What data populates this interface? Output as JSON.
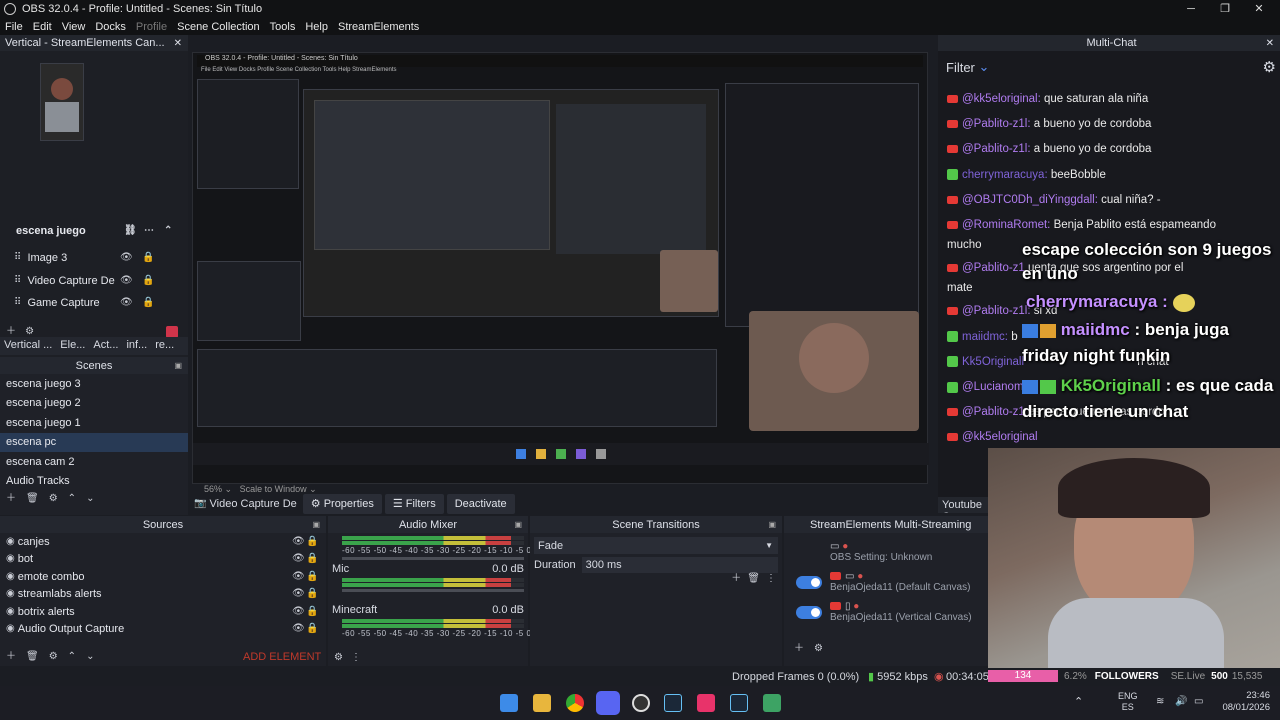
{
  "window": {
    "title": "OBS 32.0.4 - Profile: Untitled - Scenes: Sin Título"
  },
  "menu": [
    "File",
    "Edit",
    "View",
    "Docks",
    "Profile",
    "Scene Collection",
    "Tools",
    "Help",
    "StreamElements"
  ],
  "vertical_dock": {
    "title": "Vertical - StreamElements Can...",
    "scene_name": "escena juego",
    "sources": [
      "Image 3",
      "Video Capture De",
      "Game Capture"
    ],
    "tabs": [
      "Vertical ...",
      "Ele...",
      "Act...",
      "inf...",
      "re..."
    ]
  },
  "scenes": {
    "title": "Scenes",
    "items": [
      "escena juego 3",
      "escena juego 2",
      "escena juego 1",
      "escena pc",
      "escena cam 2",
      "Audio Tracks"
    ],
    "selected": 3
  },
  "preview": {
    "zoom": "56%",
    "scale": "Scale to Window"
  },
  "context_bar": {
    "source": "Video Capture De",
    "properties": "Properties",
    "filters": "Filters",
    "deactivate": "Deactivate"
  },
  "sources": {
    "title": "Sources",
    "items": [
      "canjes",
      "bot",
      "emote combo",
      "streamlabs alerts",
      "botrix alerts",
      "Audio Output Capture"
    ],
    "add_element": "ADD ELEMENT"
  },
  "mixer": {
    "title": "Audio Mixer",
    "ticks": "-60 -55 -50 -45 -40 -35 -30 -25 -20 -15 -10 -5 0",
    "channels": [
      {
        "name": "",
        "db": ""
      },
      {
        "name": "Mic",
        "db": "0.0 dB"
      },
      {
        "name": "Minecraft",
        "db": "0.0 dB"
      }
    ],
    "levels": [
      0.93,
      0.93,
      0.93
    ]
  },
  "transitions": {
    "title": "Scene Transitions",
    "type": "Fade",
    "duration_label": "Duration",
    "duration": "300 ms"
  },
  "multistream": {
    "title": "StreamElements Multi-Streaming",
    "obs_setting": "OBS Setting: Unknown",
    "account1": "BenjaOjeda11 (Default Canvas)",
    "account2": "BenjaOjeda11 (Vertical Canvas)"
  },
  "status": {
    "dropped": "Dropped Frames 0 (0.0%)",
    "kbps": "5952 kbps",
    "time": "00:34:05"
  },
  "multichat": {
    "title": "Multi-Chat",
    "filter": "Filter",
    "messages": [
      {
        "src": "yt",
        "user": "@kk5eloriginal:",
        "text": "que saturan ala niña"
      },
      {
        "src": "yt",
        "user": "@Pablito-z1l:",
        "text": "a bueno yo de cordoba"
      },
      {
        "src": "yt",
        "user": "@Pablito-z1l:",
        "text": "a bueno yo de cordoba"
      },
      {
        "src": "kk",
        "user": "cherrymaracuya:",
        "text": "beeBobble"
      },
      {
        "src": "yt",
        "user": "@OBJTC0Dh_diYinggdall:",
        "text": "cual niña? -"
      },
      {
        "src": "yt",
        "user": "@RominaRomet:",
        "text": "Benja Pablito está espameando"
      },
      {
        "src": "",
        "user": "",
        "text": "mucho"
      },
      {
        "src": "yt",
        "user": "@Pablito-z1",
        "text": "uenta que sos argentino por el"
      },
      {
        "src": "",
        "user": "",
        "text": "mate"
      },
      {
        "src": "yt",
        "user": "@Pablito-z1l:",
        "text": "si xd"
      },
      {
        "src": "kk",
        "user": "maiidmc:",
        "text": "b"
      },
      {
        "src": "kk",
        "user": "Kk5Originall",
        "text": "n chat"
      },
      {
        "src": "yt",
        "user": "@Lucianom",
        "text": ""
      },
      {
        "src": "yt",
        "user": "@Pablito-z1",
        "text": "es para que me leas perdon"
      },
      {
        "src": "yt",
        "user": "@kk5eloriginal",
        "text": ""
      }
    ],
    "youtube_tab": "Youtube C"
  },
  "overlay": {
    "line1": "escape colección son 9 juegos",
    "line2": "en uno",
    "user1": "cherrymaracuya :",
    "user2": "maiidmc",
    "msg2a": ": benja juga",
    "msg2b": "friday night funkin",
    "user3": "Kk5Originall",
    "msg3a": ": es que cada",
    "msg3b": "directo tiene un chat",
    "followers_label": "FOLLOWERS",
    "followers_num": "134",
    "se_live": "SE.Live",
    "fps": "500",
    "extra": "6.2%",
    "extra2": "15,535"
  },
  "tray": {
    "lang": "ENG",
    "region": "ES",
    "clock": "23:46",
    "date": "08/01/2026"
  },
  "colors": {
    "accent": "#3d7fe0",
    "selected": "#283a55",
    "youtube": "#e53935",
    "kick": "#53c84a"
  }
}
